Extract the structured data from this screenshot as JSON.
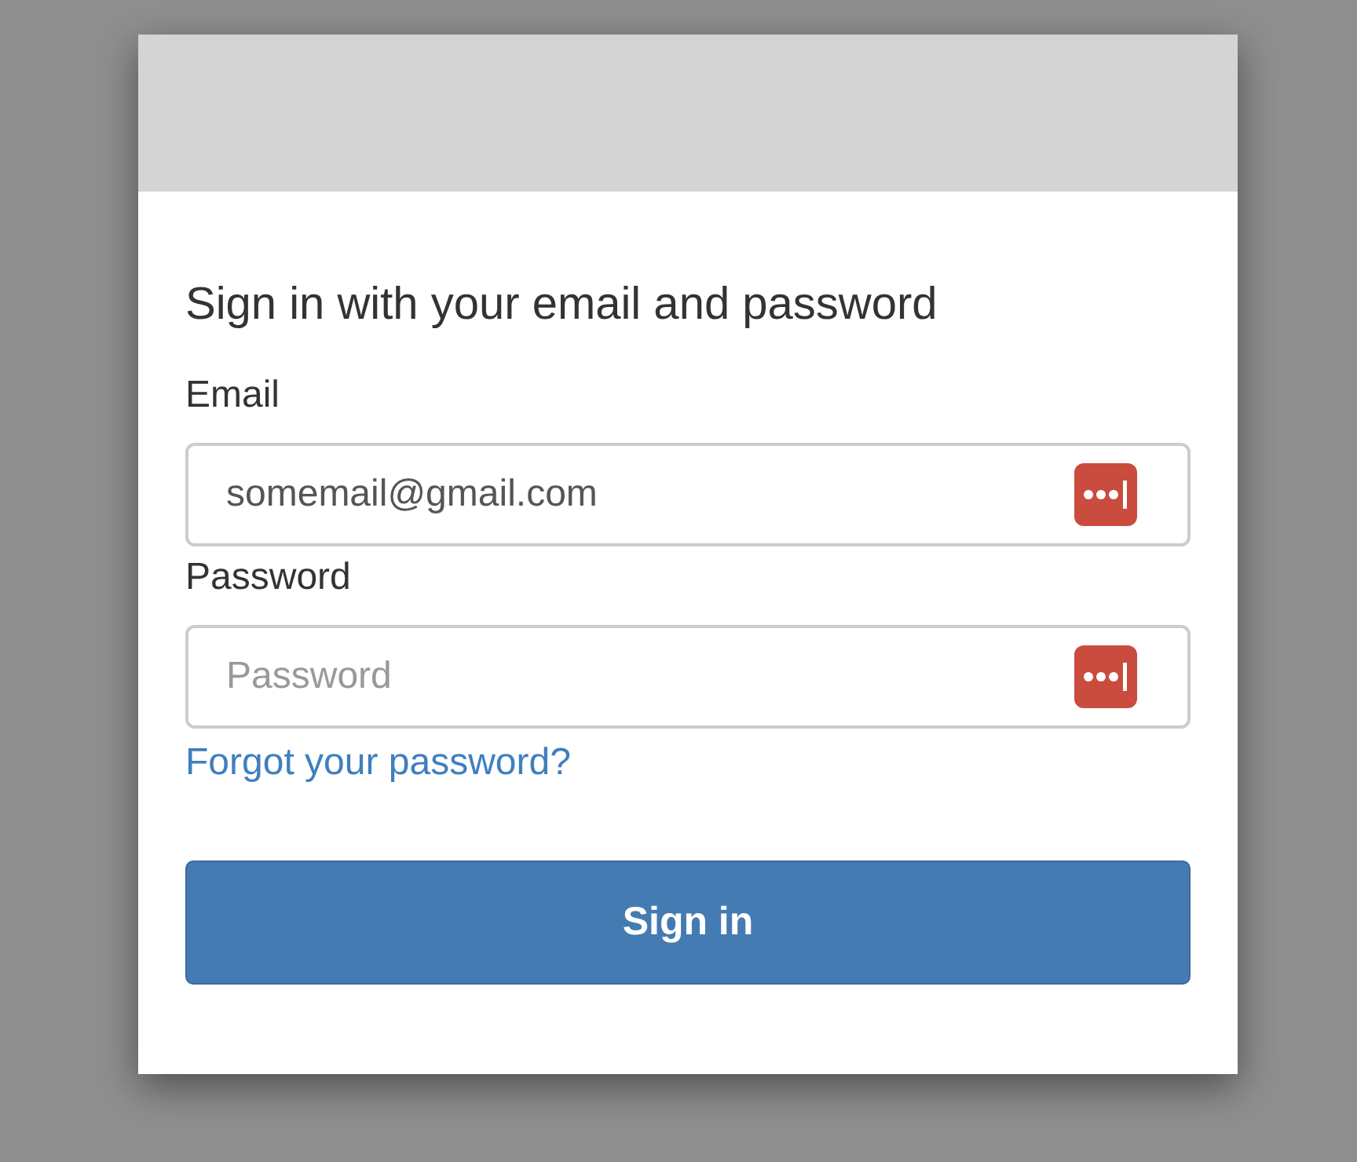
{
  "heading": "Sign in with your email and password",
  "fields": [
    {
      "label": "Email",
      "value": "somemail@gmail.com",
      "kind": "text"
    },
    {
      "label": "Password",
      "placeholder": "Password",
      "kind": "password"
    }
  ],
  "forgot_link": "Forgot your password?",
  "submit_button": "Sign in"
}
